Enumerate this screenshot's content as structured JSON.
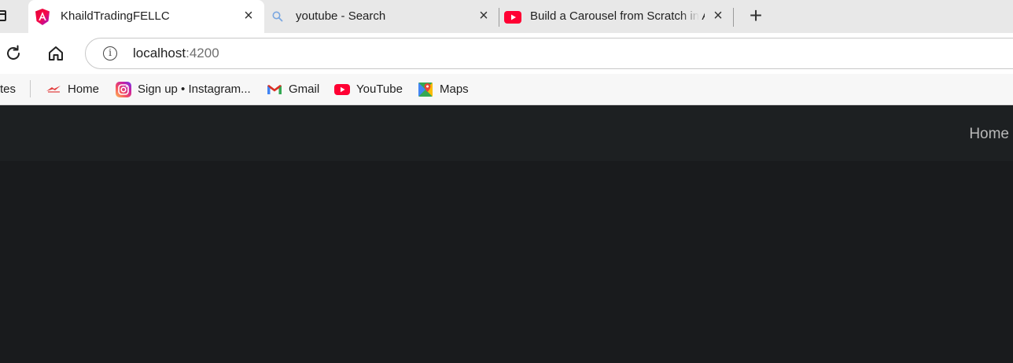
{
  "browser": {
    "tabs": [
      {
        "title": "KhaildTradingFELLC",
        "icon": "angular-icon",
        "active": true
      },
      {
        "title": "youtube - Search",
        "icon": "search-icon",
        "active": false
      },
      {
        "title": "Build a Carousel from Scratch in A",
        "icon": "youtube-icon",
        "active": false
      }
    ],
    "new_tab_label": "+",
    "close_label": "×",
    "url_host": "localhost",
    "url_port": ":4200",
    "info_label": "i"
  },
  "bookmarks": {
    "overflow_label": "tes",
    "items": [
      {
        "label": "Home",
        "icon": "home-bookmark-icon"
      },
      {
        "label": "Sign up • Instagram...",
        "icon": "instagram-icon"
      },
      {
        "label": "Gmail",
        "icon": "gmail-icon"
      },
      {
        "label": "YouTube",
        "icon": "youtube-icon"
      },
      {
        "label": "Maps",
        "icon": "maps-icon"
      }
    ]
  },
  "page": {
    "nav_home_label": "Home"
  },
  "colors": {
    "page_background": "#191b1d",
    "navbar_background": "#1d2022",
    "youtube_red": "#ff0033"
  }
}
